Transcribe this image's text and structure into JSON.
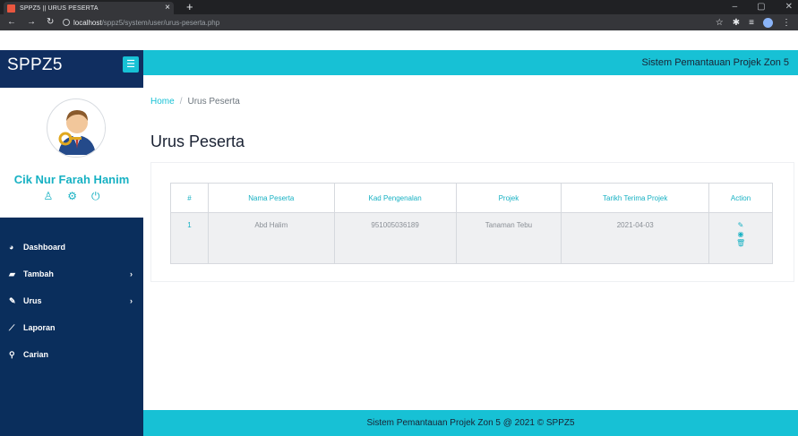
{
  "browser": {
    "tab_title": "SPPZ5 || URUS PESERTA",
    "url_host": "localhost",
    "url_path": "/sppz5/system/user/urus-peserta.php"
  },
  "app": {
    "brand": "SPPZ5",
    "header_title": "Sistem Pemantauan Projek Zon 5",
    "user_name": "Cik Nur Farah Hanim"
  },
  "sidebar": {
    "items": [
      {
        "label": "Dashboard",
        "icon": "dashboard-icon"
      },
      {
        "label": "Tambah",
        "icon": "book-icon",
        "has_children": true
      },
      {
        "label": "Urus",
        "icon": "edit-icon",
        "has_children": true
      },
      {
        "label": "Laporan",
        "icon": "chart-line-icon"
      },
      {
        "label": "Carian",
        "icon": "search-icon"
      }
    ]
  },
  "breadcrumb": {
    "home": "Home",
    "current": "Urus Peserta"
  },
  "page_title": "Urus Peserta",
  "table": {
    "headers": [
      "#",
      "Nama Peserta",
      "Kad Pengenalan",
      "Projek",
      "Tarikh Terima Projek",
      "Action"
    ],
    "rows": [
      {
        "num": "1",
        "nama": "Abd Halim",
        "ic": "951005036189",
        "projek": "Tanaman Tebu",
        "tarikh": "2021-04-03"
      }
    ]
  },
  "footer": "Sistem Pemantauan Projek Zon 5 @ 2021 © SPPZ5",
  "colors": {
    "accent": "#17c1d5",
    "sidebar": "#0a2e5c",
    "brand_bg": "#102e60"
  }
}
